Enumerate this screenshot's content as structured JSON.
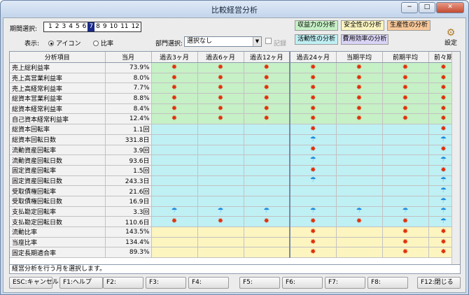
{
  "window": {
    "title": "比較経営分析",
    "minimize_glyph": "−",
    "maximize_glyph": "□",
    "close_glyph": "✕"
  },
  "toolbar": {
    "period_label": "期間選択:",
    "periods": [
      "1",
      "2",
      "3",
      "4",
      "5",
      "6",
      "7",
      "8",
      "9",
      "10",
      "11",
      "12"
    ],
    "selected_period": "7",
    "display_label": "表示:",
    "radio_icon_label": "アイコン",
    "radio_ratio_label": "比率",
    "dept_label": "部門選択:",
    "dept_value": "選択なし",
    "checkbox_label": "記録",
    "setting_label": "設定"
  },
  "analysis_buttons": [
    {
      "label": "収益力の分析",
      "color": "#c6f0c6"
    },
    {
      "label": "安全性の分析",
      "color": "#fcf5c0"
    },
    {
      "label": "生産性の分析",
      "color": "#f8c89a"
    },
    {
      "label": "活動性の分析",
      "color": "#bff0f4"
    },
    {
      "label": "費用効率の分析",
      "color": "#d9d4f6"
    }
  ],
  "table": {
    "headers": [
      "分析項目",
      "当月",
      "過去3ヶ月",
      "過去6ヶ月",
      "過去12ヶ月",
      "過去24ヶ月",
      "当期平均",
      "前期平均",
      "前々期"
    ],
    "rows": [
      {
        "name": "売上総利益率",
        "value": "73.9%",
        "group": "green",
        "icons": [
          "sun",
          "sun",
          "sun",
          "sun",
          "sun",
          "sun",
          "sun"
        ]
      },
      {
        "name": "売上高営業利益率",
        "value": "8.0%",
        "group": "green",
        "icons": [
          "sun",
          "sun",
          "sun",
          "sun",
          "sun",
          "sun",
          "sun"
        ]
      },
      {
        "name": "売上高経常利益率",
        "value": "7.7%",
        "group": "green",
        "icons": [
          "sun",
          "sun",
          "sun",
          "sun",
          "sun",
          "sun",
          "sun"
        ]
      },
      {
        "name": "総資本営業利益率",
        "value": "8.8%",
        "group": "green",
        "icons": [
          "sun",
          "sun",
          "sun",
          "sun",
          "sun",
          "sun",
          "sun"
        ]
      },
      {
        "name": "総資本経常利益率",
        "value": "8.4%",
        "group": "green",
        "icons": [
          "sun",
          "sun",
          "sun",
          "sun",
          "sun",
          "sun",
          "sun"
        ]
      },
      {
        "name": "自己資本経常利益率",
        "value": "12.4%",
        "group": "green",
        "icons": [
          "sun",
          "sun",
          "sun",
          "sun",
          "sun",
          "sun",
          "sun"
        ]
      },
      {
        "name": "総資本回転率",
        "value": "1.1回",
        "group": "cyan",
        "icons": [
          "",
          "",
          "",
          "sun",
          "",
          "",
          "sun"
        ]
      },
      {
        "name": "総資本回転日数",
        "value": "331.8日",
        "group": "cyan",
        "icons": [
          "",
          "",
          "",
          "umbrella",
          "",
          "",
          "umbrella"
        ]
      },
      {
        "name": "流動資産回転率",
        "value": "3.9回",
        "group": "cyan",
        "icons": [
          "",
          "",
          "",
          "sun",
          "",
          "",
          "sun"
        ]
      },
      {
        "name": "流動資産回転日数",
        "value": "93.6日",
        "group": "cyan",
        "icons": [
          "",
          "",
          "",
          "umbrella",
          "",
          "",
          "umbrella"
        ]
      },
      {
        "name": "固定資産回転率",
        "value": "1.5回",
        "group": "cyan",
        "icons": [
          "",
          "",
          "",
          "sun",
          "",
          "",
          "sun"
        ]
      },
      {
        "name": "固定資産回転日数",
        "value": "243.3日",
        "group": "cyan",
        "icons": [
          "",
          "",
          "",
          "umbrella",
          "",
          "",
          "umbrella"
        ]
      },
      {
        "name": "受取債権回転率",
        "value": "21.6回",
        "group": "cyan",
        "icons": [
          "",
          "",
          "",
          "",
          "",
          "",
          "umbrella"
        ]
      },
      {
        "name": "受取債権回転日数",
        "value": "16.9日",
        "group": "cyan",
        "icons": [
          "",
          "",
          "",
          "",
          "",
          "",
          "umbrella"
        ]
      },
      {
        "name": "支払勘定回転率",
        "value": "3.3回",
        "group": "cyan",
        "icons": [
          "umbrella",
          "umbrella",
          "umbrella",
          "umbrella",
          "umbrella",
          "umbrella",
          "umbrella"
        ]
      },
      {
        "name": "支払勘定回転日数",
        "value": "110.6日",
        "group": "cyan",
        "icons": [
          "sun",
          "sun",
          "sun",
          "sun",
          "sun",
          "sun",
          "umbrella"
        ]
      },
      {
        "name": "流動比率",
        "value": "143.5%",
        "group": "yellow",
        "icons": [
          "",
          "",
          "",
          "sun",
          "",
          "sun",
          "sun"
        ]
      },
      {
        "name": "当座比率",
        "value": "134.4%",
        "group": "yellow",
        "icons": [
          "",
          "",
          "",
          "sun",
          "",
          "sun",
          "sun"
        ]
      },
      {
        "name": "固定長期適合率",
        "value": "89.3%",
        "group": "yellow",
        "icons": [
          "",
          "",
          "",
          "sun",
          "",
          "sun",
          "sun"
        ]
      }
    ]
  },
  "status": {
    "message": "経営分析を行う月を選択します。"
  },
  "fkeys": [
    "ESC:キャンセル",
    "F1:ヘルプ",
    "F2:",
    "F3:",
    "F4:",
    "F5:",
    "F6:",
    "F7:",
    "F8:",
    "F12:閉じる"
  ],
  "icons": {
    "sun": "sun-icon",
    "umbrella": "umbrella-icon"
  },
  "icon_glyphs": {
    "sun": "✹",
    "umbrella": "☂"
  }
}
